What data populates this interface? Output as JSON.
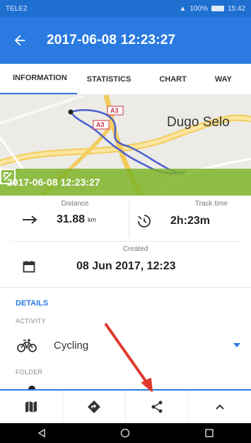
{
  "status_bar": {
    "carrier": "TELE2",
    "battery": "100%",
    "time": "15:42"
  },
  "app_bar": {
    "title": "2017-06-08 12:23:27",
    "back_icon": "arrow-left-icon"
  },
  "tabs": [
    {
      "label": "INFORMATION",
      "active": true
    },
    {
      "label": "STATISTICS",
      "active": false
    },
    {
      "label": "CHART",
      "active": false
    },
    {
      "label": "WAY",
      "active": false
    }
  ],
  "map": {
    "place_label": "Dugo Selo",
    "road_shield_1": "A3",
    "road_shield_2": "A3",
    "overlay_title": "2017-06-08 12:23:27",
    "overlay_color": "#7eb428"
  },
  "stats": {
    "distance": {
      "label": "Distance",
      "value": "31.88",
      "unit": "km"
    },
    "track_time": {
      "label": "Track time",
      "value": "2h:23m"
    },
    "created": {
      "label": "Created",
      "value": "08 Jun 2017, 12:23"
    }
  },
  "details": {
    "section_title": "DETAILS",
    "activity_label": "ACTIVITY",
    "activity_value": "Cycling",
    "folder_label": "FOLDER"
  },
  "bottom_nav": [
    "map-icon",
    "directions-icon",
    "share-icon",
    "chevron-up-icon"
  ],
  "colors": {
    "primary": "#2a7ae2",
    "status_bar": "#1e6fd0",
    "accent_arrow": "#e03a2e"
  }
}
